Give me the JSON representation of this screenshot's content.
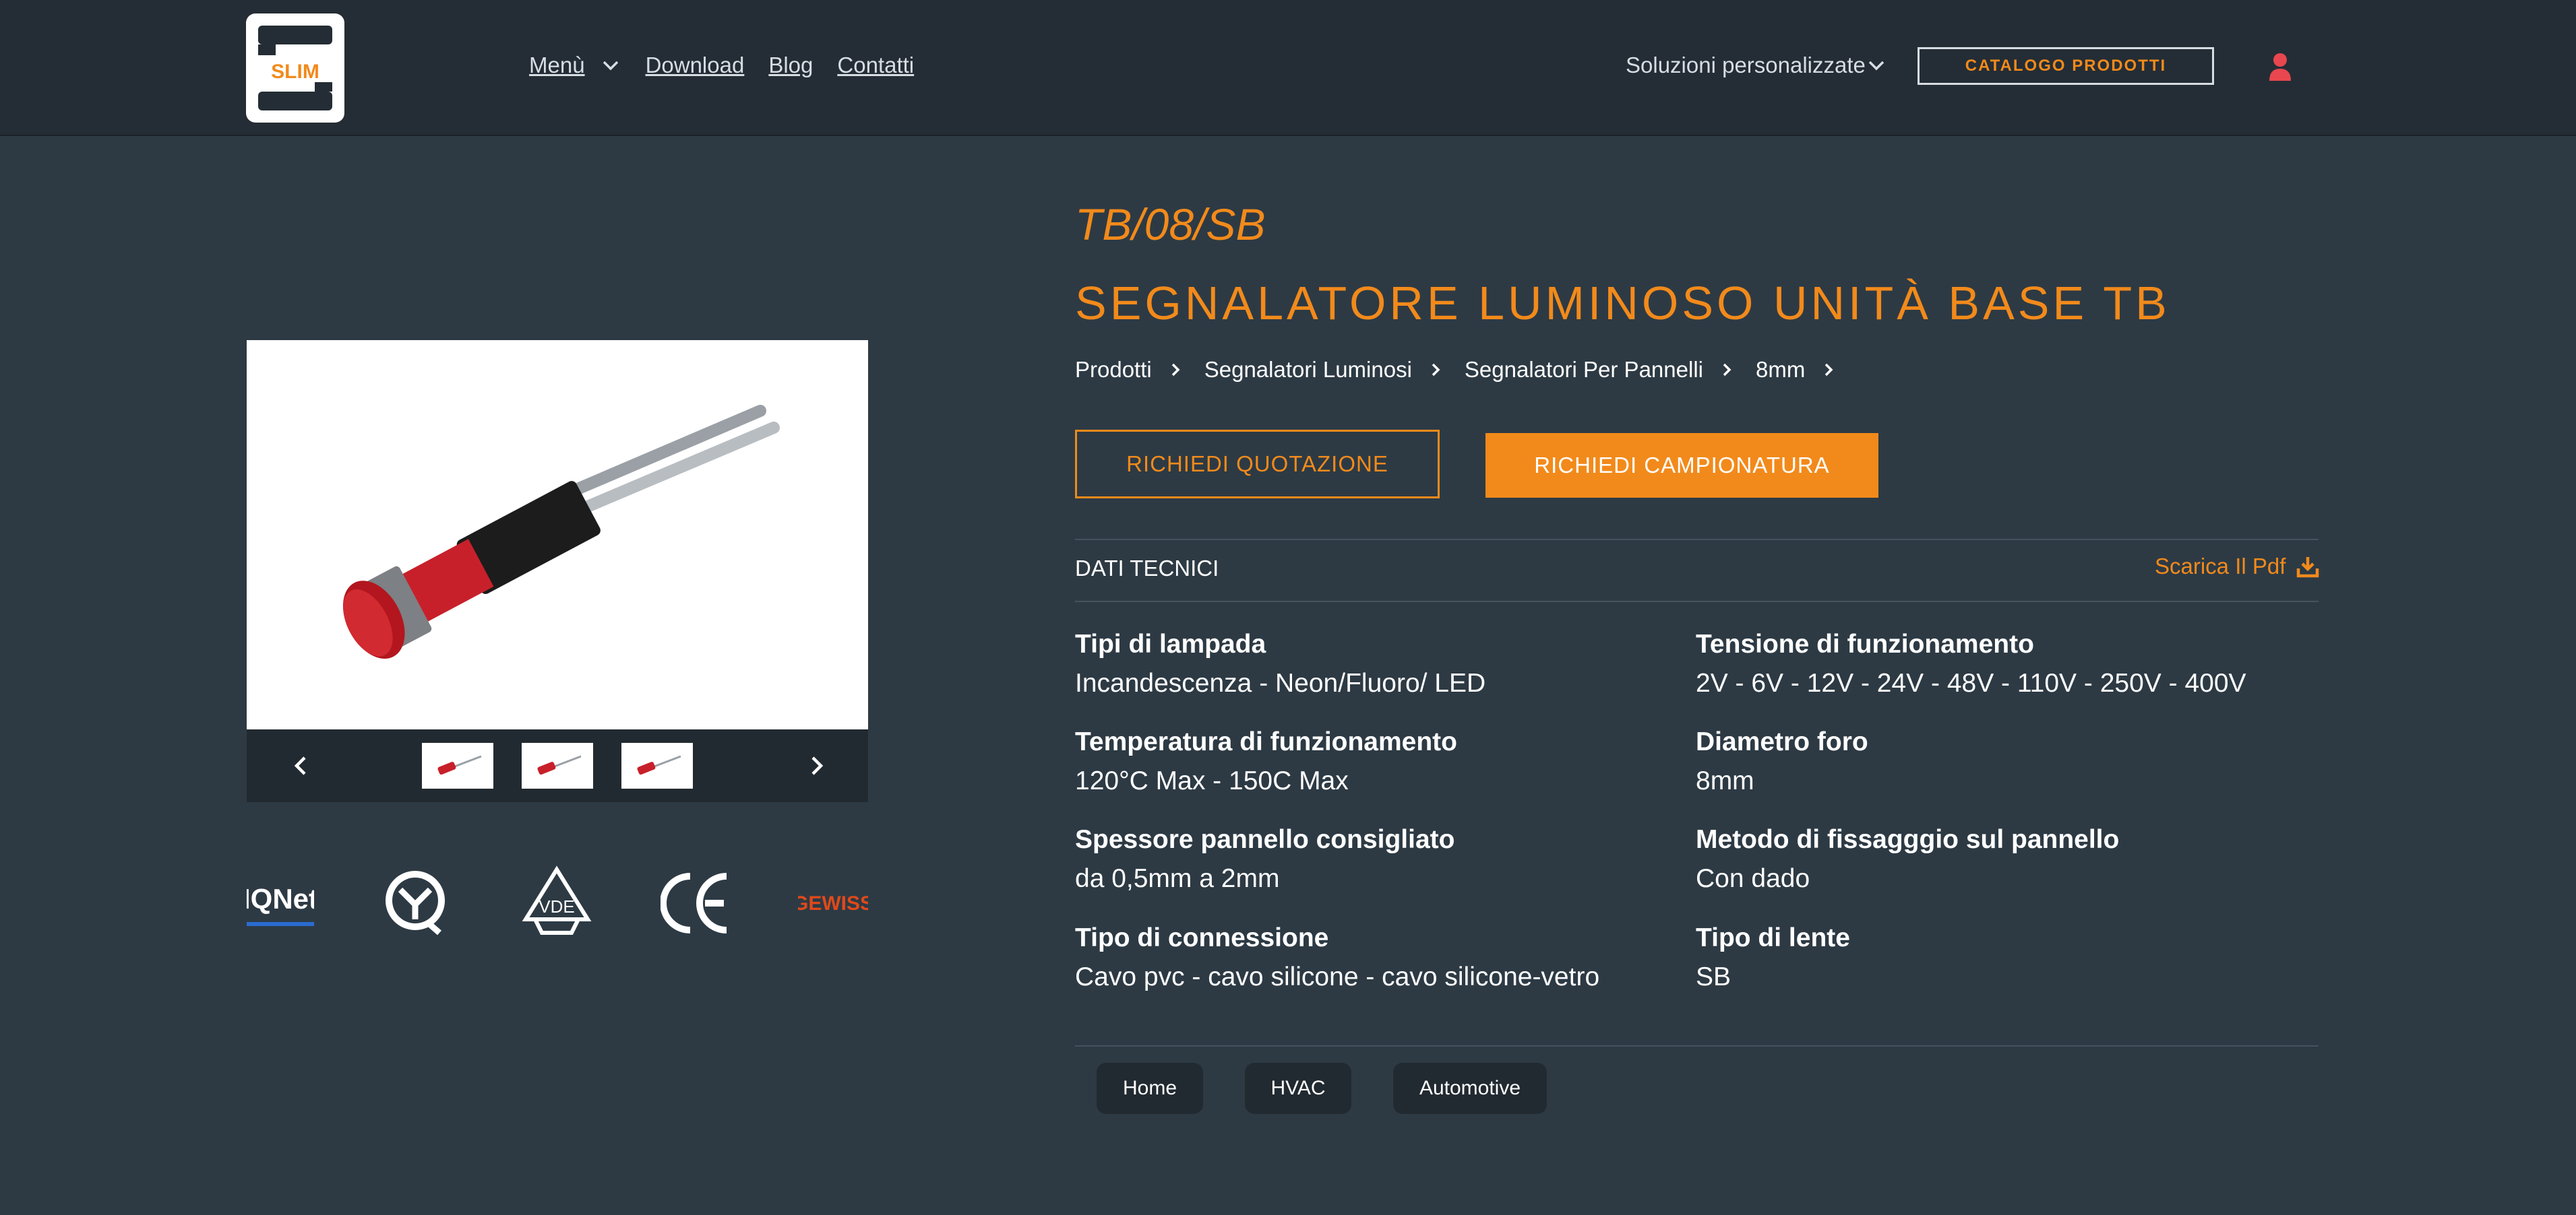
{
  "header": {
    "logo_text": "SLIM",
    "nav": [
      {
        "label": "Menù"
      },
      {
        "label": "Download"
      },
      {
        "label": "Blog"
      },
      {
        "label": "Contatti"
      }
    ],
    "solutions_label": "Soluzioni personalizzate",
    "catalog_label": "CATALOGO PRODOTTI"
  },
  "product": {
    "code": "TB/08/SB",
    "title": "SEGNALATORE LUMINOSO UNITÀ BASE TB",
    "breadcrumb": [
      "Prodotti",
      "Segnalatori Luminosi",
      "Segnalatori Per Pannelli",
      "8mm"
    ],
    "quote_button": "RICHIEDI QUOTAZIONE",
    "sample_button": "RICHIEDI CAMPIONATURA",
    "section_label": "DATI TECNICI",
    "pdf_label": "Scarica Il Pdf",
    "specs": [
      {
        "key": "Tipi di lampada",
        "value": "Incandescenza - Neon/Fluoro/ LED"
      },
      {
        "key": "Tensione di funzionamento",
        "value": "2V - 6V - 12V - 24V - 48V - 110V - 250V - 400V"
      },
      {
        "key": "Temperatura di funzionamento",
        "value": "120°C Max - 150C Max"
      },
      {
        "key": "Diametro foro",
        "value": "8mm"
      },
      {
        "key": "Spessore pannello consigliato",
        "value": "da 0,5mm a 2mm"
      },
      {
        "key": "Metodo di fissagggio sul pannello",
        "value": "Con dado"
      },
      {
        "key": "Tipo di connessione",
        "value": "Cavo pvc - cavo silicone - cavo silicone-vetro"
      },
      {
        "key": "Tipo di lente",
        "value": "SB"
      }
    ],
    "tags": [
      "Home",
      "HVAC",
      "Automotive"
    ]
  },
  "certifications": [
    {
      "name": "iqnet-logo",
      "text": "IQNet"
    },
    {
      "name": "imq-logo",
      "text": ""
    },
    {
      "name": "vde-logo",
      "text": "VDE"
    },
    {
      "name": "ce-logo",
      "text": "CE"
    },
    {
      "name": "gewiss-logo",
      "text": "GEWISS"
    }
  ],
  "colors": {
    "accent": "#f28a1b",
    "header_bg": "#242d35",
    "page_bg": "#2d3a44",
    "user_icon": "#e8474f"
  }
}
